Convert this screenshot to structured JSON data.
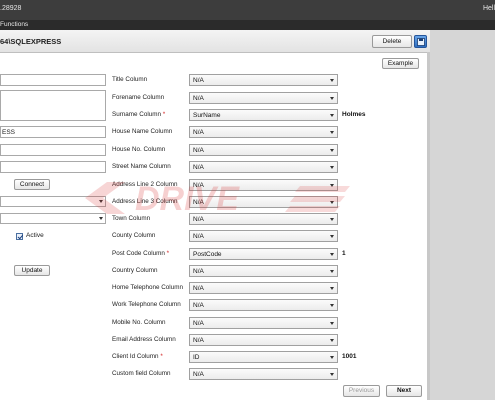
{
  "titlebar": {
    "version": ".28928",
    "greeting": "Hell"
  },
  "menubar": {
    "item": "Functions"
  },
  "header": {
    "connection": "64\\SQLEXPRESS",
    "delete_label": "Delete",
    "save_icon": "save-icon"
  },
  "example_label": "Example",
  "left": {
    "server_value": "ESS",
    "connect_label": "Connect",
    "active_label": "Active",
    "active_checked": true,
    "update_label": "Update"
  },
  "mapping_rows": [
    {
      "label": "Title Column",
      "required": false,
      "value": "N/A",
      "example": ""
    },
    {
      "label": "Forename Column",
      "required": false,
      "value": "N/A",
      "example": ""
    },
    {
      "label": "Surname Column",
      "required": true,
      "value": "SurName",
      "example": "Holmes"
    },
    {
      "label": "House Name Column",
      "required": false,
      "value": "N/A",
      "example": ""
    },
    {
      "label": "House No. Column",
      "required": false,
      "value": "N/A",
      "example": ""
    },
    {
      "label": "Street Name Column",
      "required": false,
      "value": "N/A",
      "example": ""
    },
    {
      "label": "Address Line 2 Column",
      "required": false,
      "value": "N/A",
      "example": ""
    },
    {
      "label": "Address Line 3 Column",
      "required": false,
      "value": "N/A",
      "example": ""
    },
    {
      "label": "Town Column",
      "required": false,
      "value": "N/A",
      "example": ""
    },
    {
      "label": "County Column",
      "required": false,
      "value": "N/A",
      "example": ""
    },
    {
      "label": "Post Code Column",
      "required": true,
      "value": "PostCode",
      "example": "1"
    },
    {
      "label": "Country Column",
      "required": false,
      "value": "N/A",
      "example": ""
    },
    {
      "label": "Home Telephone Column",
      "required": false,
      "value": "N/A",
      "example": ""
    },
    {
      "label": "Work Telephone Column",
      "required": false,
      "value": "N/A",
      "example": ""
    },
    {
      "label": "Mobile No. Column",
      "required": false,
      "value": "N/A",
      "example": ""
    },
    {
      "label": "Email Address Column",
      "required": false,
      "value": "N/A",
      "example": ""
    },
    {
      "label": "Client Id Column",
      "required": true,
      "value": "ID",
      "example": "1001"
    },
    {
      "label": "Custom field Column",
      "required": false,
      "value": "N/A",
      "example": ""
    }
  ],
  "required_marker": "*",
  "footer": {
    "previous_label": "Previous",
    "next_label": "Next"
  },
  "watermark_text": "DRIVE",
  "colors": {
    "titlebar": "#3d3d3d",
    "required": "#d21c1c",
    "accent": "#2f6fc0"
  }
}
